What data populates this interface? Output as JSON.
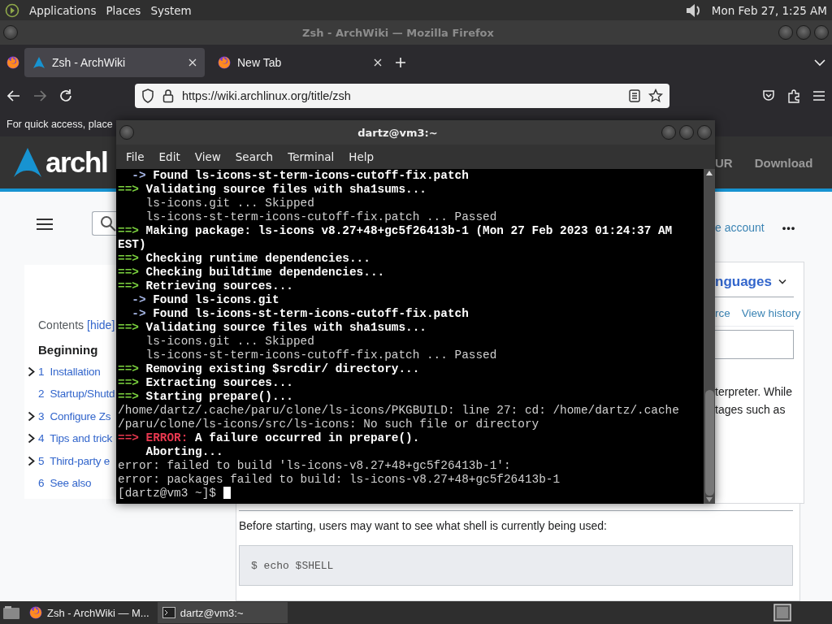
{
  "top_panel": {
    "menus": [
      "Applications",
      "Places",
      "System"
    ],
    "clock": "Mon Feb 27, 1:25 AM"
  },
  "browser": {
    "window_title": "Zsh - ArchWiki — Mozilla Firefox",
    "tabs": [
      {
        "label": "Zsh - ArchWiki",
        "selected": true
      },
      {
        "label": "New Tab",
        "selected": false
      }
    ],
    "back": {
      "disabled": false
    },
    "forward": {
      "disabled": true
    },
    "url": "https://wiki.archlinux.org/title/zsh",
    "bookmarks_hint": "For quick access, place"
  },
  "wiki": {
    "logo_text": "archl",
    "nav_links": [
      "UR",
      "Download"
    ],
    "account_link": "e account",
    "more": "•••",
    "toc": {
      "title": "Contents",
      "toggle": "[hide]",
      "section": "Beginning",
      "items": [
        {
          "number": "1",
          "label": "Installation",
          "expandable": true
        },
        {
          "number": "2",
          "label": "Startup/Shutd",
          "expandable": false
        },
        {
          "number": "3",
          "label": "Configure Zs",
          "expandable": true
        },
        {
          "number": "4",
          "label": "Tips and trick",
          "expandable": true
        },
        {
          "number": "5",
          "label": "Third-party e",
          "expandable": true
        },
        {
          "number": "6",
          "label": "See also",
          "expandable": false
        }
      ]
    },
    "languages": "nguages",
    "actions": [
      "rce",
      "View history"
    ],
    "paragraph_lines": [
      "terpreter. While",
      "tages such as"
    ],
    "intro": "Before starting, users may want to see what shell is currently being used:",
    "code": "$ echo $SHELL"
  },
  "terminal": {
    "title": "dartz@vm3:~",
    "menus": [
      "File",
      "Edit",
      "View",
      "Search",
      "Terminal",
      "Help"
    ],
    "lines": [
      [
        {
          "kind": "arrow",
          "text": "  -> "
        },
        {
          "kind": "bold",
          "text": "Found ls-icons-st-term-icons-cutoff-fix.patch"
        }
      ],
      [
        {
          "kind": "step",
          "text": "==> "
        },
        {
          "kind": "bold",
          "text": "Validating source files with sha1sums..."
        }
      ],
      [
        {
          "kind": "plain",
          "text": "    ls-icons.git ... Skipped"
        }
      ],
      [
        {
          "kind": "plain",
          "text": "    ls-icons-st-term-icons-cutoff-fix.patch ... Passed"
        }
      ],
      [
        {
          "kind": "step",
          "text": "==> "
        },
        {
          "kind": "bold",
          "text": "Making package: ls-icons v8.27+48+gc5f26413b-1 (Mon 27 Feb 2023 01:24:37 AM"
        }
      ],
      [
        {
          "kind": "bold",
          "text": "EST)"
        }
      ],
      [
        {
          "kind": "step",
          "text": "==> "
        },
        {
          "kind": "bold",
          "text": "Checking runtime dependencies..."
        }
      ],
      [
        {
          "kind": "step",
          "text": "==> "
        },
        {
          "kind": "bold",
          "text": "Checking buildtime dependencies..."
        }
      ],
      [
        {
          "kind": "step",
          "text": "==> "
        },
        {
          "kind": "bold",
          "text": "Retrieving sources..."
        }
      ],
      [
        {
          "kind": "arrow",
          "text": "  -> "
        },
        {
          "kind": "bold",
          "text": "Found ls-icons.git"
        }
      ],
      [
        {
          "kind": "arrow",
          "text": "  -> "
        },
        {
          "kind": "bold",
          "text": "Found ls-icons-st-term-icons-cutoff-fix.patch"
        }
      ],
      [
        {
          "kind": "step",
          "text": "==> "
        },
        {
          "kind": "bold",
          "text": "Validating source files with sha1sums..."
        }
      ],
      [
        {
          "kind": "plain",
          "text": "    ls-icons.git ... Skipped"
        }
      ],
      [
        {
          "kind": "plain",
          "text": "    ls-icons-st-term-icons-cutoff-fix.patch ... Passed"
        }
      ],
      [
        {
          "kind": "step",
          "text": "==> "
        },
        {
          "kind": "bold",
          "text": "Removing existing $srcdir/ directory..."
        }
      ],
      [
        {
          "kind": "step",
          "text": "==> "
        },
        {
          "kind": "bold",
          "text": "Extracting sources..."
        }
      ],
      [
        {
          "kind": "step",
          "text": "==> "
        },
        {
          "kind": "bold",
          "text": "Starting prepare()..."
        }
      ],
      [
        {
          "kind": "plain",
          "text": "/home/dartz/.cache/paru/clone/ls-icons/PKGBUILD: line 27: cd: /home/dartz/.cache"
        }
      ],
      [
        {
          "kind": "plain",
          "text": "/paru/clone/ls-icons/src/ls-icons: No such file or directory"
        }
      ],
      [
        {
          "kind": "error",
          "text": "==> ERROR:"
        },
        {
          "kind": "bold",
          "text": " A failure occurred in prepare()."
        }
      ],
      [
        {
          "kind": "bold",
          "text": "    Aborting..."
        }
      ],
      [
        {
          "kind": "plain",
          "text": "error: failed to build 'ls-icons-v8.27+48+gc5f26413b-1':"
        }
      ],
      [
        {
          "kind": "plain",
          "text": "error: packages failed to build: ls-icons-v8.27+48+gc5f26413b-1"
        }
      ],
      [
        {
          "kind": "plain",
          "text": "[dartz@vm3 ~]$ "
        },
        {
          "kind": "cursor"
        }
      ]
    ]
  },
  "taskbar": {
    "tasks": [
      {
        "kind": "browser",
        "label": "Zsh - ArchWiki — M...",
        "selected": false
      },
      {
        "kind": "terminal",
        "label": "dartz@vm3:~",
        "selected": true
      }
    ]
  }
}
